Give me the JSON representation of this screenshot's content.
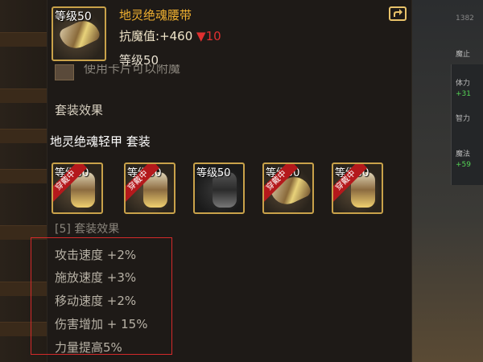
{
  "item": {
    "level_badge": "等级50",
    "name": "地灵绝魂腰带",
    "stat_label": "抗魔值:",
    "stat_value": "+460",
    "stat_change_arrow": "▼",
    "stat_change": "10",
    "level_text": "等级50",
    "usage_text": "使用卡片可以附魔"
  },
  "set": {
    "section_title": "套装效果",
    "name": "地灵绝魂轻甲 套装",
    "pieces": [
      {
        "level": "等级50",
        "equipped": true,
        "ribbon": "穿戴中"
      },
      {
        "level": "等级50",
        "equipped": true,
        "ribbon": "穿戴中"
      },
      {
        "level": "等级50",
        "equipped": false,
        "ribbon": ""
      },
      {
        "level": "等级50",
        "equipped": true,
        "ribbon": "穿戴中"
      },
      {
        "level": "等级50",
        "equipped": true,
        "ribbon": "穿戴中"
      }
    ],
    "count_line": "[5] 套装效果",
    "bonuses": [
      "攻击速度 +2%",
      "施放速度 +3%",
      "移动速度 +2%",
      "伤害增加 + 15%",
      "力量提高5%"
    ]
  },
  "background": {
    "right_num": "1382",
    "right_stats": [
      {
        "label": "魔止",
        "value": ""
      },
      {
        "label": "体力",
        "value": "+31"
      },
      {
        "label": "智力",
        "value": ""
      },
      {
        "label": "魔法",
        "value": "+59"
      }
    ]
  },
  "colors": {
    "accent": "#f0b030",
    "frame": "#c9a24a",
    "highlight_box": "#d42a2a",
    "down": "#e03030"
  }
}
